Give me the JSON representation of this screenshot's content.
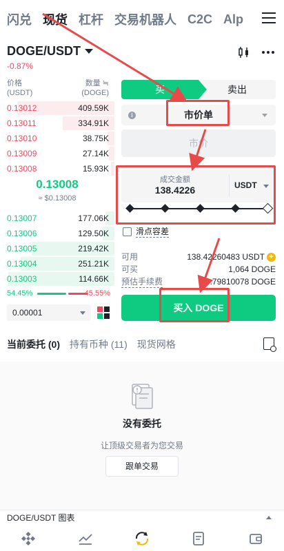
{
  "top_tabs": [
    "闪兑",
    "现货",
    "杠杆",
    "交易机器人",
    "C2C",
    "Alp"
  ],
  "pair": {
    "name": "DOGE/USDT",
    "change": "-0.87%"
  },
  "orderbook": {
    "price_label": "价格",
    "price_unit": "(USDT)",
    "qty_label": "数量 ≒",
    "qty_unit": "(DOGE)",
    "asks": [
      {
        "price": "0.13012",
        "qty": "409.59K",
        "depth": 0.85
      },
      {
        "price": "0.13011",
        "qty": "334.91K",
        "depth": 0.45
      },
      {
        "price": "0.13010",
        "qty": "38.75K",
        "depth": 0.06
      },
      {
        "price": "0.13009",
        "qty": "27.14K",
        "depth": 0.05
      },
      {
        "price": "0.13008",
        "qty": "15.93K",
        "depth": 0.03
      }
    ],
    "mid_price": "0.13008",
    "mid_usd": "≈ $0.13008",
    "bids": [
      {
        "price": "0.13007",
        "qty": "177.06K",
        "depth": 0.08
      },
      {
        "price": "0.13006",
        "qty": "129.50K",
        "depth": 0.1
      },
      {
        "price": "0.13005",
        "qty": "219.42K",
        "depth": 0.72
      },
      {
        "price": "0.13004",
        "qty": "251.21K",
        "depth": 0.82
      },
      {
        "price": "0.13003",
        "qty": "114.66K",
        "depth": 0.93
      }
    ],
    "buy_ratio": "54.45%",
    "sell_ratio": "45.55%",
    "precision": "0.00001"
  },
  "form": {
    "buy_tab": "买",
    "sell_tab": "卖出",
    "order_type": "市价单",
    "market_price_placeholder": "市价",
    "amount_label": "成交金额",
    "amount_value": "138.4226",
    "amount_currency": "USDT",
    "slippage_label": "滑点容差",
    "available_label": "可用",
    "available_value": "138.42260483 USDT",
    "can_buy_label": "可买",
    "can_buy_value": "1,064 DOGE",
    "fee_label": "预估手续费",
    "fee_value": "0.79810078 DOGE",
    "buy_button": "买入 DOGE"
  },
  "orders": {
    "tabs": [
      "当前委托 (0)",
      "持有币种 (11)",
      "现货网格"
    ],
    "empty_title": "没有委托",
    "empty_sub": "让顶级交易者为您交易",
    "copy_button": "跟单交易"
  },
  "chart_bar_label": "DOGE/USDT 图表",
  "colors": {
    "green": "#0ecb81",
    "red": "#f6465d",
    "yellow": "#f0b90b",
    "highlight": "#e84a4a"
  },
  "nav_icons": [
    "binance-logo-icon",
    "markets-icon",
    "trade-icon",
    "futures-icon",
    "wallet-icon"
  ]
}
